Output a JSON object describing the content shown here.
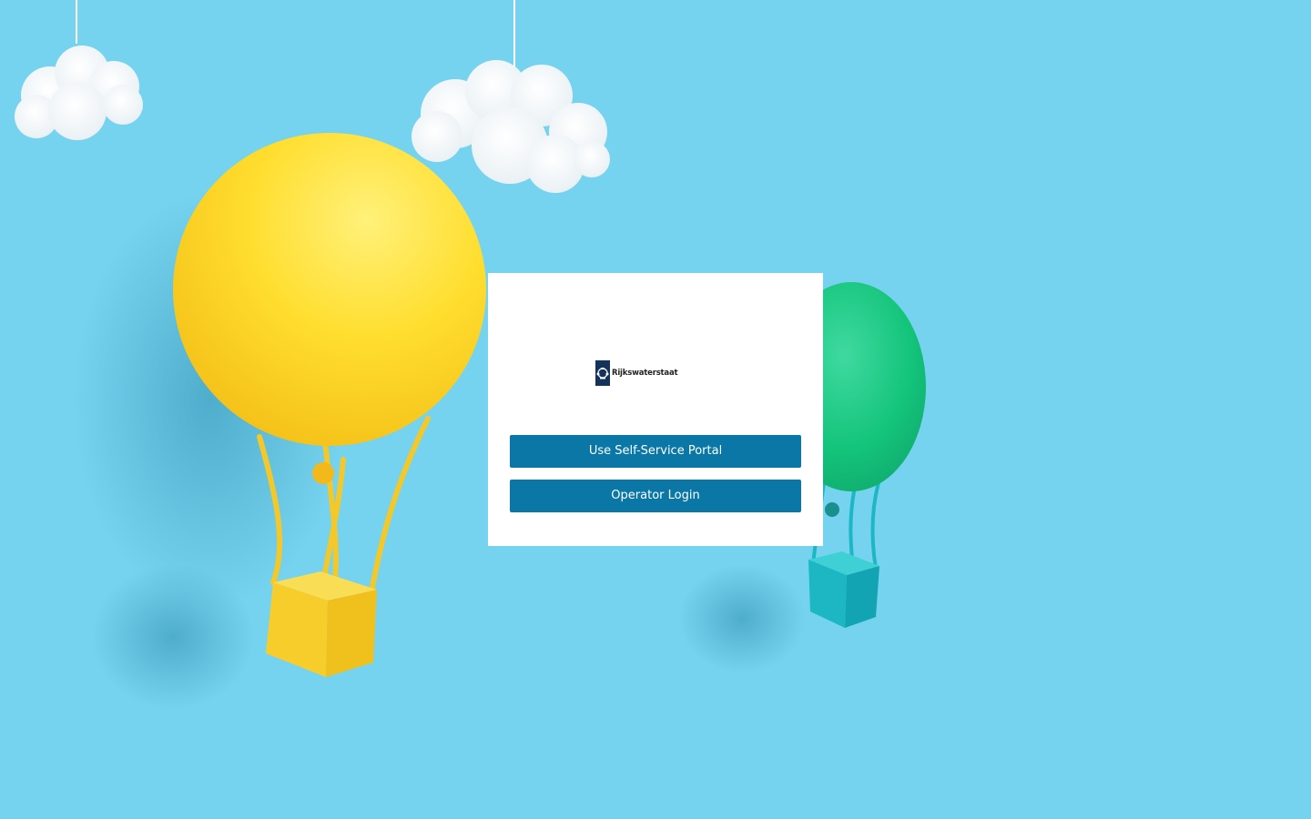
{
  "background": {
    "sky_color": "#76d3ef",
    "yellow_balloon_color": "#ffd91f",
    "green_balloon_color": "#1fc57f",
    "yellow_basket_color": "#f7cd2c",
    "teal_basket_color": "#1cb7c3"
  },
  "login": {
    "logo_text": "Rijkswaterstaat",
    "logo_color": "#15325b",
    "self_service_button": "Use Self-Service Portal",
    "operator_button": "Operator Login",
    "button_color": "#0a77a6"
  }
}
